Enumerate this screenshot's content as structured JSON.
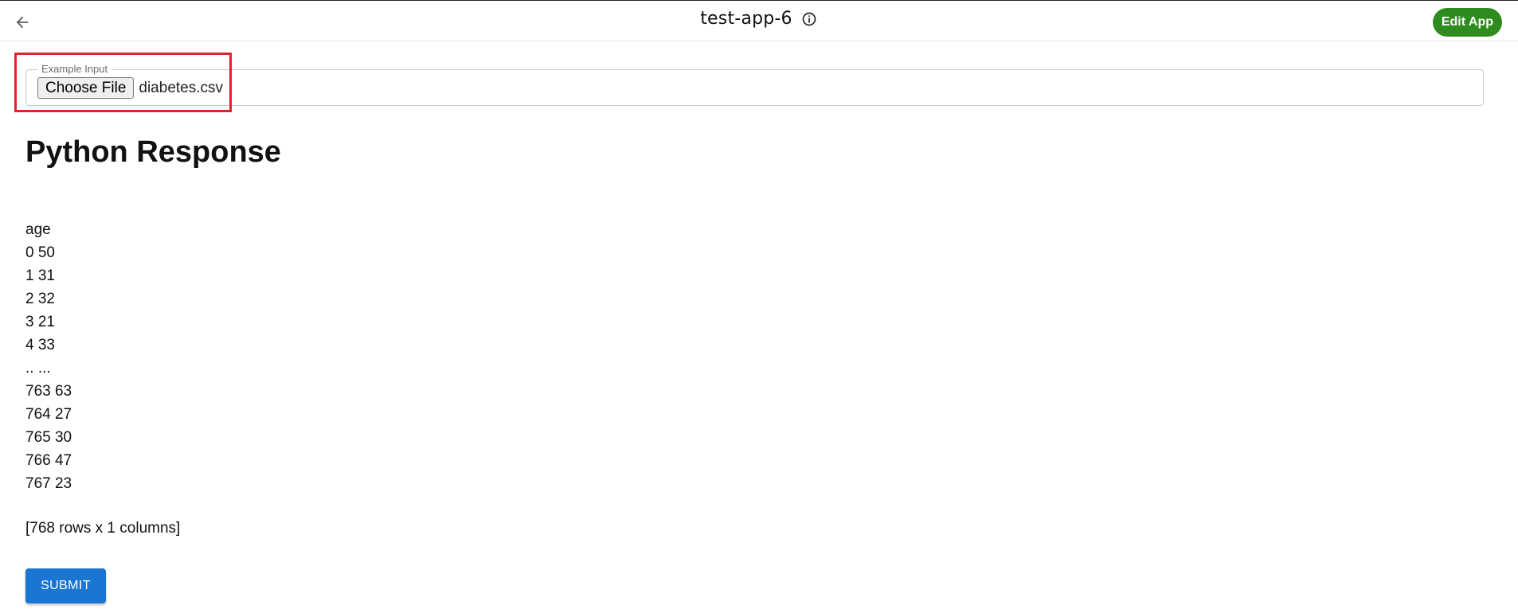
{
  "header": {
    "back_icon": "arrow-left-icon",
    "title": "test-app-6",
    "info_icon": "info-circle-icon",
    "edit_button_label": "Edit App",
    "edit_button_color": "#2e8b1e"
  },
  "input_field": {
    "legend": "Example Input",
    "choose_file_label": "Choose File",
    "file_name": "diabetes.csv",
    "highlight_color": "#e0222b"
  },
  "response": {
    "title": "Python Response",
    "header_line": "age",
    "rows": [
      "0 50",
      "1 31",
      "2 32",
      "3 21",
      "4 33",
      ".. ...",
      "763 63",
      "764 27",
      "765 30",
      "766 47",
      "767 23"
    ],
    "summary": "[768 rows x 1 columns]"
  },
  "submit": {
    "label": "SUBMIT",
    "color": "#1976d2"
  }
}
